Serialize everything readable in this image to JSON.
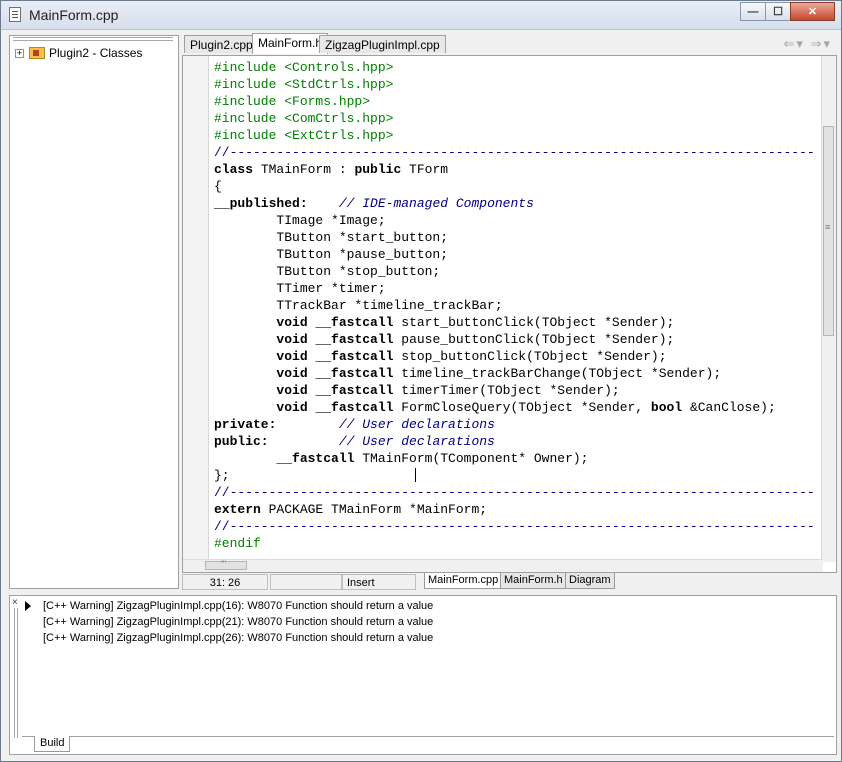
{
  "window": {
    "title": "MainForm.cpp"
  },
  "tree": {
    "expander": "+",
    "item_label": "Plugin2 - Classes"
  },
  "tabs": [
    {
      "label": "Plugin2.cpp"
    },
    {
      "label": "MainForm.h"
    },
    {
      "label": "ZigzagPluginImpl.cpp"
    }
  ],
  "nav": {
    "back": "⇐",
    "back_dropdown": "▾",
    "forward": "⇒",
    "forward_dropdown": "▾"
  },
  "code_lines": [
    [
      {
        "t": "#include <Controls.hpp>",
        "c": "pp"
      }
    ],
    [
      {
        "t": "#include <StdCtrls.hpp>",
        "c": "pp"
      }
    ],
    [
      {
        "t": "#include <Forms.hpp>",
        "c": "pp"
      }
    ],
    [
      {
        "t": "#include <ComCtrls.hpp>",
        "c": "pp"
      }
    ],
    [
      {
        "t": "#include <ExtCtrls.hpp>",
        "c": "pp"
      }
    ],
    [
      {
        "t": "//---------------------------------------------------------------------------",
        "c": "sep"
      }
    ],
    [
      {
        "t": "class",
        "c": "kw"
      },
      {
        "t": " TMainForm : ",
        "c": ""
      },
      {
        "t": "public",
        "c": "kw"
      },
      {
        "t": " TForm",
        "c": ""
      }
    ],
    [
      {
        "t": "{",
        "c": ""
      }
    ],
    [
      {
        "t": "__published:",
        "c": "kw"
      },
      {
        "t": "    ",
        "c": ""
      },
      {
        "t": "// IDE-managed Components",
        "c": "cm"
      }
    ],
    [
      {
        "t": "        TImage *Image;",
        "c": ""
      }
    ],
    [
      {
        "t": "        TButton *start_button;",
        "c": ""
      }
    ],
    [
      {
        "t": "        TButton *pause_button;",
        "c": ""
      }
    ],
    [
      {
        "t": "        TButton *stop_button;",
        "c": ""
      }
    ],
    [
      {
        "t": "        TTimer *timer;",
        "c": ""
      }
    ],
    [
      {
        "t": "        TTrackBar *timeline_trackBar;",
        "c": ""
      }
    ],
    [
      {
        "t": "        ",
        "c": ""
      },
      {
        "t": "void",
        "c": "kw"
      },
      {
        "t": " ",
        "c": ""
      },
      {
        "t": "__fastcall",
        "c": "kw"
      },
      {
        "t": " start_buttonClick(TObject *Sender);",
        "c": ""
      }
    ],
    [
      {
        "t": "        ",
        "c": ""
      },
      {
        "t": "void",
        "c": "kw"
      },
      {
        "t": " ",
        "c": ""
      },
      {
        "t": "__fastcall",
        "c": "kw"
      },
      {
        "t": " pause_buttonClick(TObject *Sender);",
        "c": ""
      }
    ],
    [
      {
        "t": "        ",
        "c": ""
      },
      {
        "t": "void",
        "c": "kw"
      },
      {
        "t": " ",
        "c": ""
      },
      {
        "t": "__fastcall",
        "c": "kw"
      },
      {
        "t": " stop_buttonClick(TObject *Sender);",
        "c": ""
      }
    ],
    [
      {
        "t": "        ",
        "c": ""
      },
      {
        "t": "void",
        "c": "kw"
      },
      {
        "t": " ",
        "c": ""
      },
      {
        "t": "__fastcall",
        "c": "kw"
      },
      {
        "t": " timeline_trackBarChange(TObject *Sender);",
        "c": ""
      }
    ],
    [
      {
        "t": "        ",
        "c": ""
      },
      {
        "t": "void",
        "c": "kw"
      },
      {
        "t": " ",
        "c": ""
      },
      {
        "t": "__fastcall",
        "c": "kw"
      },
      {
        "t": " timerTimer(TObject *Sender);",
        "c": ""
      }
    ],
    [
      {
        "t": "        ",
        "c": ""
      },
      {
        "t": "void",
        "c": "kw"
      },
      {
        "t": " ",
        "c": ""
      },
      {
        "t": "__fastcall",
        "c": "kw"
      },
      {
        "t": " FormCloseQuery(TObject *Sender, ",
        "c": ""
      },
      {
        "t": "bool",
        "c": "kw"
      },
      {
        "t": " &CanClose);",
        "c": ""
      }
    ],
    [
      {
        "t": "private:",
        "c": "kw"
      },
      {
        "t": "        ",
        "c": ""
      },
      {
        "t": "// User declarations",
        "c": "cm"
      }
    ],
    [
      {
        "t": "public:",
        "c": "kw"
      },
      {
        "t": "         ",
        "c": ""
      },
      {
        "t": "// User declarations",
        "c": "cm"
      }
    ],
    [
      {
        "t": "        ",
        "c": ""
      },
      {
        "t": "__fastcall",
        "c": "kw"
      },
      {
        "t": " TMainForm(TComponent* Owner);",
        "c": ""
      }
    ],
    [
      {
        "t": "};",
        "c": ""
      }
    ],
    [
      {
        "t": "//---------------------------------------------------------------------------",
        "c": "sep"
      }
    ],
    [
      {
        "t": "extern",
        "c": "kw"
      },
      {
        "t": " PACKAGE TMainForm *MainForm;",
        "c": ""
      }
    ],
    [
      {
        "t": "//---------------------------------------------------------------------------",
        "c": "sep"
      }
    ],
    [
      {
        "t": "#endif",
        "c": "pp"
      }
    ]
  ],
  "scroll": {
    "hthumb_label": "'''",
    "vthumb_grip": "≡"
  },
  "status": {
    "position": "31:  26",
    "blank": "",
    "mode": "Insert",
    "file_tabs": [
      "MainForm.cpp",
      "MainForm.h",
      "Diagram"
    ]
  },
  "messages": {
    "close": "×",
    "items": [
      "[C++ Warning] ZigzagPluginImpl.cpp(16): W8070 Function should return a value",
      "[C++ Warning] ZigzagPluginImpl.cpp(21): W8070 Function should return a value",
      "[C++ Warning] ZigzagPluginImpl.cpp(26): W8070 Function should return a value"
    ],
    "tab": "Build"
  },
  "window_buttons": {
    "minimize": "—",
    "maximize": "☐",
    "close": "✕"
  }
}
